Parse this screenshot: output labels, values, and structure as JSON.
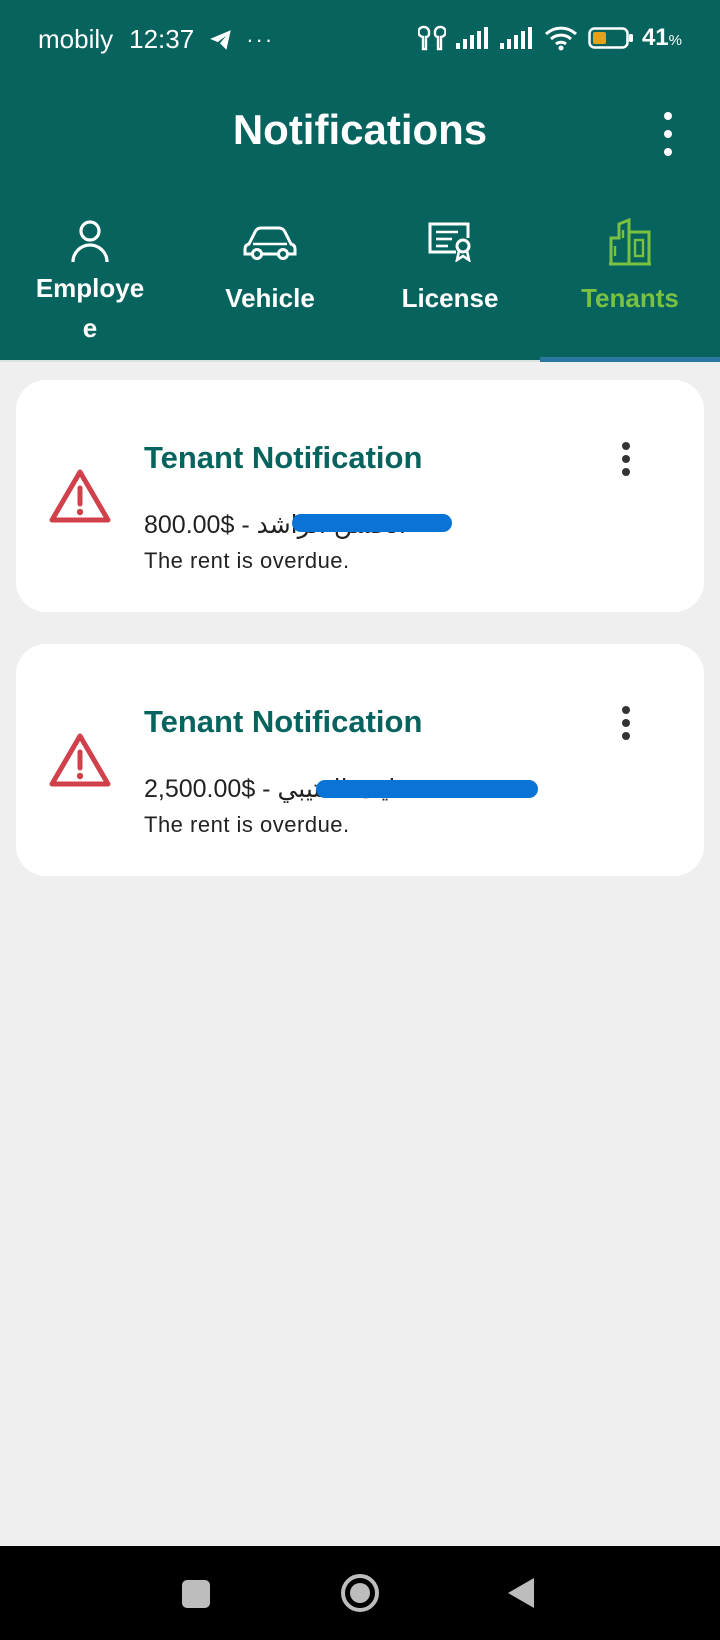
{
  "status_bar": {
    "carrier": "mobily",
    "time": "12:37",
    "dots": "···",
    "battery_percent": "41",
    "battery_unit": "%",
    "battery_level": 0.41,
    "battery_color": "#e3a21a"
  },
  "app_bar": {
    "title": "Notifications",
    "background": "#07635d"
  },
  "tabs": [
    {
      "label": "Employe\ne",
      "icon": "person-icon",
      "active": false
    },
    {
      "label": "Vehicle",
      "icon": "car-icon",
      "active": false
    },
    {
      "label": "License",
      "icon": "certificate-icon",
      "active": false
    },
    {
      "label": "Tenants",
      "icon": "buildings-icon",
      "active": true
    }
  ],
  "notifications": [
    {
      "title": "Tenant Notification",
      "amount": "800.00$",
      "separator": " - ",
      "tenant_name": "الحسن الراشد",
      "message": "The rent is overdue.",
      "icon": "warning-icon"
    },
    {
      "title": "Tenant Notification",
      "amount": "2,500.00$",
      "separator": " - ",
      "tenant_name": "نايف العتيبي",
      "message": "The rent is overdue.",
      "icon": "warning-icon"
    }
  ],
  "colors": {
    "primary": "#07635d",
    "active_tab": "#7ac142",
    "alert": "#d0414b",
    "redaction": "#0a74d6"
  }
}
